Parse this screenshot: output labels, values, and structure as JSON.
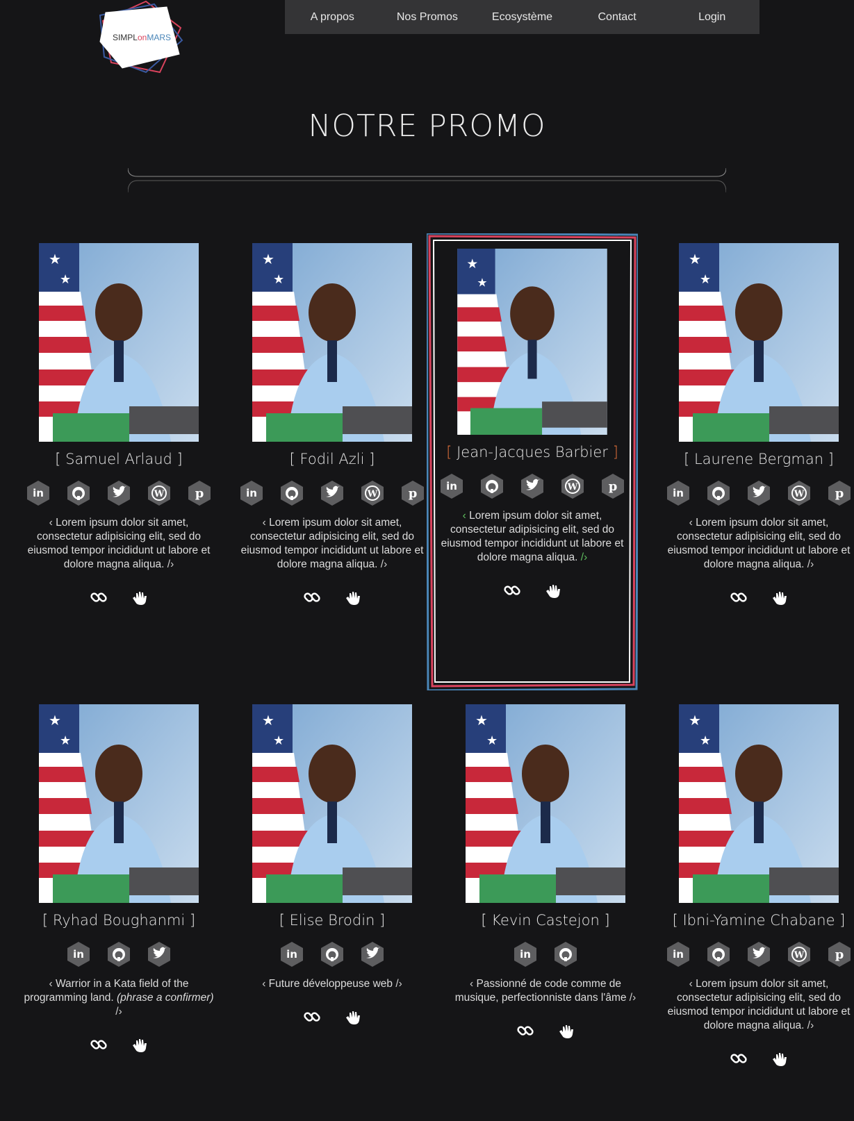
{
  "header": {
    "logo_text": "SIMPLonMARS",
    "nav": [
      "A propos",
      "Nos Promos",
      "Ecosystème",
      "Contact",
      "Login"
    ]
  },
  "page": {
    "title": "NOTRE PROMO"
  },
  "people": [
    {
      "name": "[ Samuel Arlaud ]",
      "socials": [
        "linkedin",
        "github",
        "twitter",
        "wordpress",
        "pinterest"
      ],
      "desc_open": "‹ ",
      "desc": "Lorem ipsum dolor sit amet, consectetur adipisicing elit, sed do eiusmod tempor incididunt ut labore et dolore magna aliqua.",
      "desc_em": "",
      "desc_close": " /›"
    },
    {
      "name": "[ Fodil Azli ]",
      "socials": [
        "linkedin",
        "github",
        "twitter",
        "wordpress",
        "pinterest"
      ],
      "desc_open": "‹ ",
      "desc": "Lorem ipsum dolor sit amet, consectetur adipisicing elit, sed do eiusmod tempor incididunt ut labore et dolore magna aliqua.",
      "desc_em": "",
      "desc_close": " /›"
    },
    {
      "name": "Jean-Jacques Barbier",
      "socials": [
        "linkedin",
        "github",
        "twitter",
        "wordpress",
        "pinterest"
      ],
      "desc_open": "‹ ",
      "desc": "Lorem ipsum dolor sit amet, consectetur adipisicing elit, sed do eiusmod tempor incididunt ut labore et dolore magna aliqua.",
      "desc_em": "",
      "desc_close": " /›",
      "featured": true
    },
    {
      "name": "[ Laurene Bergman ]",
      "socials": [
        "linkedin",
        "github",
        "twitter",
        "wordpress",
        "pinterest"
      ],
      "desc_open": "‹ ",
      "desc": "Lorem ipsum dolor sit amet, consectetur adipisicing elit, sed do eiusmod tempor incididunt ut labore et dolore magna aliqua.",
      "desc_em": "",
      "desc_close": " /›"
    },
    {
      "name": "[ Ryhad Boughanmi ]",
      "socials": [
        "linkedin",
        "github",
        "twitter"
      ],
      "desc_open": "‹ ",
      "desc": "Warrior in a Kata field of the programming land. ",
      "desc_em": "(phrase a confirmer)",
      "desc_close": " /›"
    },
    {
      "name": "[ Elise Brodin ]",
      "socials": [
        "linkedin",
        "github",
        "twitter"
      ],
      "desc_open": "‹ ",
      "desc": "Future développeuse web",
      "desc_em": "",
      "desc_close": " /›"
    },
    {
      "name": "[ Kevin Castejon ]",
      "socials": [
        "linkedin",
        "github"
      ],
      "desc_open": "‹ ",
      "desc": "Passionné de code comme de musique, perfectionniste dans l'âme",
      "desc_em": "",
      "desc_close": " /›"
    },
    {
      "name": "[ Ibni-Yamine Chabane ]",
      "socials": [
        "linkedin",
        "github",
        "twitter",
        "wordpress",
        "pinterest"
      ],
      "desc_open": "‹ ",
      "desc": "Lorem ipsum dolor sit amet, consectetur adipisicing elit, sed do eiusmod tempor incididunt ut labore et dolore magna aliqua.",
      "desc_em": "",
      "desc_close": " /›"
    }
  ],
  "colors": {
    "background": "#151517",
    "nav_bg": "#343436",
    "hex_icon": "#5e5e60",
    "bracket_accent": "#e0703a",
    "tag_accent": "#5fbf5f",
    "frame_red": "#d9435d",
    "frame_blue": "#4a86b8"
  }
}
